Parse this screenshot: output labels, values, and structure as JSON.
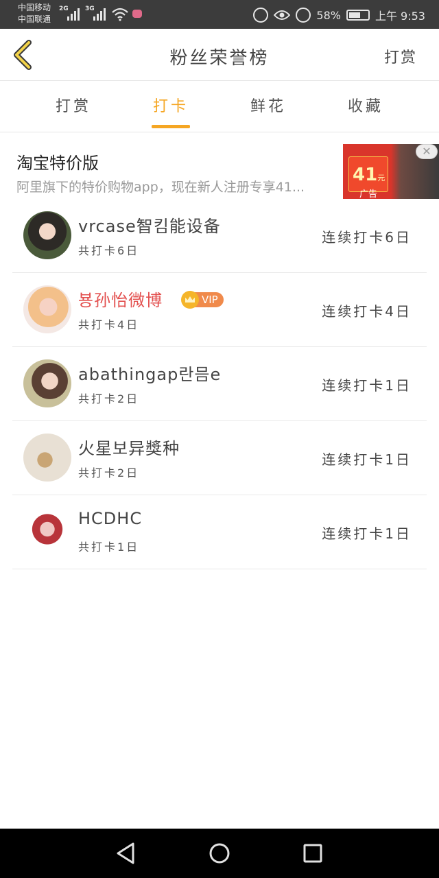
{
  "status_bar": {
    "carrier_1": "中国移动",
    "carrier_2": "中国联通",
    "network_1": "2G",
    "network_2": "3G",
    "battery_percent": "58%",
    "time": "上午 9:53"
  },
  "header": {
    "title": "粉丝荣誉榜",
    "reward_label": "打赏"
  },
  "tabs": [
    {
      "label": "打赏",
      "active": false
    },
    {
      "label": "打卡",
      "active": true
    },
    {
      "label": "鲜花",
      "active": false
    },
    {
      "label": "收藏",
      "active": false
    }
  ],
  "ad": {
    "title": "淘宝特价版",
    "description": "阿里旗下的特价购物app，现在新人注册专享41...",
    "price": "41",
    "price_unit": "元",
    "label": "广告",
    "close_symbol": "✕"
  },
  "fans": [
    {
      "name": "vrcase智킴能设备",
      "total": "共打卡6日",
      "streak": "连续打卡6日",
      "vip": false
    },
    {
      "name": "뵹孙怡微博",
      "total": "共打卡4日",
      "streak": "连续打卡4日",
      "vip": true,
      "vip_label": "VIP"
    },
    {
      "name": "abathingap란믐e",
      "total": "共打卡2日",
      "streak": "连续打卡1日",
      "vip": false
    },
    {
      "name": "火星보异獎种",
      "total": "共打卡2日",
      "streak": "连续打卡1日",
      "vip": false
    },
    {
      "name": "HCDHC",
      "total": "共打卡1日",
      "streak": "连续打卡1日",
      "vip": false
    }
  ],
  "colors": {
    "accent": "#f5a623",
    "vip_name": "#e3504f",
    "status_bar_bg": "#3c3c3c",
    "nav_bar_bg": "#000000"
  },
  "icons": {
    "back": "chevron-left-icon",
    "nav_back": "triangle-back-icon",
    "nav_home": "circle-home-icon",
    "nav_recent": "square-recent-icon"
  }
}
